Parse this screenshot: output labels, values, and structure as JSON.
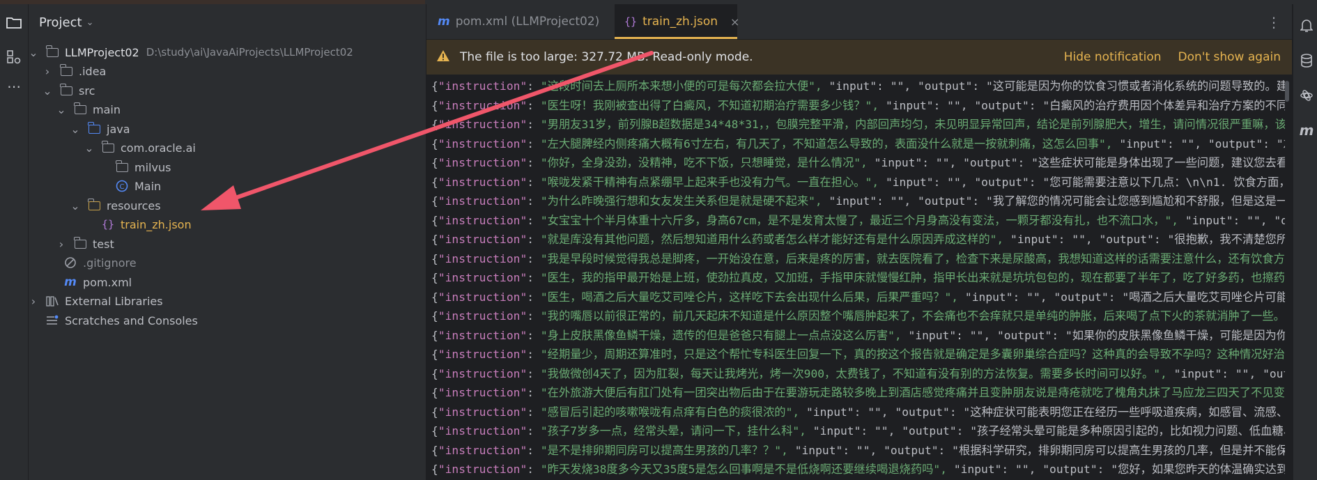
{
  "project_panel": {
    "title": "Project",
    "tree": [
      {
        "label": "LLMProject02",
        "path": "D:\\study\\ai\\JavaAiProjects\\LLMProject02"
      },
      {
        "label": ".idea"
      },
      {
        "label": "src"
      },
      {
        "label": "main"
      },
      {
        "label": "java"
      },
      {
        "label": "com.oracle.ai"
      },
      {
        "label": "milvus"
      },
      {
        "label": "Main"
      },
      {
        "label": "resources"
      },
      {
        "label": "train_zh.json"
      },
      {
        "label": "test"
      },
      {
        "label": ".gitignore"
      },
      {
        "label": "pom.xml"
      },
      {
        "label": "External Libraries"
      },
      {
        "label": "Scratches and Consoles"
      }
    ]
  },
  "tabs": [
    {
      "label": "pom.xml (LLMProject02)"
    },
    {
      "label": "train_zh.json"
    }
  ],
  "banner": {
    "message": "The file is too large: 327.72 MB. Read-only mode.",
    "hide": "Hide notification",
    "dont_show": "Don't show again"
  },
  "editor_lines": [
    {
      "i": "这段时间去上厕所本来想小便的可是每次都会拉大便",
      "rest": "\"input\": \"\", \"output\": \"这可能是因为你的饮食习惯或者消化系统的问题导致的。建议"
    },
    {
      "i": "医生呀！我刚被查出得了白癜风，不知道初期治疗需要多少钱？",
      "rest": "\"input\": \"\", \"output\": \"白癜风的治疗费用因个体差异和治疗方案的不同而"
    },
    {
      "i": "男朋友31岁，前列腺B超数据是34*48*31，，包膜完整平滑，内部回声均匀，未见明显异常回声，结论是前列腺肥大，增生，请问情况很严重嘛，该怎"
    },
    {
      "i": "左大腿脾经内侧疼痛大概有6寸左右，有几天了，不知道怎么导致的，表面没什么就是一按就刺痛，这怎么回事",
      "rest": "\"input\": \"\", \"output\": \"左"
    },
    {
      "i": "你好，全身没劲，没精神，吃不下饭，只想睡觉，是什么情况",
      "rest": "\"input\": \"\", \"output\": \"这些症状可能是身体出现了一些问题，建议您去看医"
    },
    {
      "i": "喉咙发紧干精神有点紧绷早上起来手也没有力气。一直在担心。",
      "rest": "\"input\": \"\", \"output\": \"您可能需要注意以下几点：\\n\\n1. 饮食方面，"
    },
    {
      "i": "为什么昨晚强行想和女友发生关系但是就是硬不起来",
      "rest": "\"input\": \"\", \"output\": \"我了解您的情况可能会让您感到尴尬和不舒服，但是这是一个"
    },
    {
      "i": "女宝宝十个半月体重十六斤多，身高67cm，是不是发育太慢了，最近三个月身高没有变法，一颗牙都没有扎，也不流口水，",
      "rest": "\"input\": \"\", \"o"
    },
    {
      "i": "就是库没有其他问题，然后想知道用什么药或者怎么样才能好还有是什么原因弄成这样的",
      "rest": "\"input\": \"\", \"output\": \"很抱歉，我不清楚您所指"
    },
    {
      "i": "我是早段时候觉得我总是脚疼，一开始没在意，后来是疼的厉害，就去医院看了，检查下来是尿酸高，我想知道这样的话需要注意什么，还有饮食方面"
    },
    {
      "i": "医生，我的指甲最开始是上班，使劲拉真皮，又加班，手指甲床就慢慢红肿，指甲长出来就是坑坑包包的，现在都要了半年了，吃了好多药，也擦药了"
    },
    {
      "i": "医生，喝酒之后大量吃艾司唑仑片，这样吃下去会出现什么后果，后果严重吗？",
      "rest": "\"input\": \"\", \"output\": \"喝酒之后大量吃艾司唑仑片可能会"
    },
    {
      "i": "我的嘴唇以前很正常的，前几天起床不知道是什么原因整个嘴唇肿起来了，不会痛也不会痒就只是单纯的肿胀，后来喝了点下火的茶就消肿了一些。几"
    },
    {
      "i": "身上皮肤黑像鱼鳞干燥，遗传的但是爸爸只有腿上一点点没这么厉害",
      "rest": "\"input\": \"\", \"output\": \"如果你的皮肤黑像鱼鳞干燥，可能是因为你的"
    },
    {
      "i": "经期量少，周期还算准时，只是这个帮忙专科医生回复一下，真的按这个报告就是确定是多囊卵巢综合症吗？这种真的会导致不孕吗？这种情况好治疗吗"
    },
    {
      "i": "我做微创4天了，因为肛裂，每天让我烤光，烤一次900，太费钱了，不知道有没有别的方法恢复。需要多长时间可以好。",
      "rest": "\"input\": \"\", \"output"
    },
    {
      "i": "在外旅游大便后有肛门处有一团突出物后由于在要游玩走路较多晚上到酒店感觉疼痛并且变肿朋友说是痔疮就吃了槐角丸抹了马应龙三四天了不见变小"
    },
    {
      "i": "感冒后引起的咳嗽喉咙有点痒有白色的痰很浓的",
      "rest": "\"input\": \"\", \"output\": \"这种症状可能表明您正在经历一些呼吸道疾病，如感冒、流感、支"
    },
    {
      "i": "孩子7岁多一点，经常头晕，请问一下，挂什么科",
      "rest": "\"input\": \"\", \"output\": \"孩子经常头晕可能是多种原因引起的，比如视力问题、低血糖、"
    },
    {
      "i": "是不是排卵期同房可以提高生男孩的几率？？",
      "rest": "\"input\": \"\", \"output\": \"根据科学研究，排卵期同房可以提高生男孩的几率，但是并不能保证"
    },
    {
      "i": "昨天发烧38度多今天又35度5是怎么回事啊是不是低烧啊还要继续喝退烧药吗",
      "rest": "\"input\": \"\", \"output\": \"您好，如果您昨天的体温确实达到了"
    }
  ],
  "icons": {
    "accent_yellow": "#e6b450",
    "arrow_color": "#f0566a"
  }
}
